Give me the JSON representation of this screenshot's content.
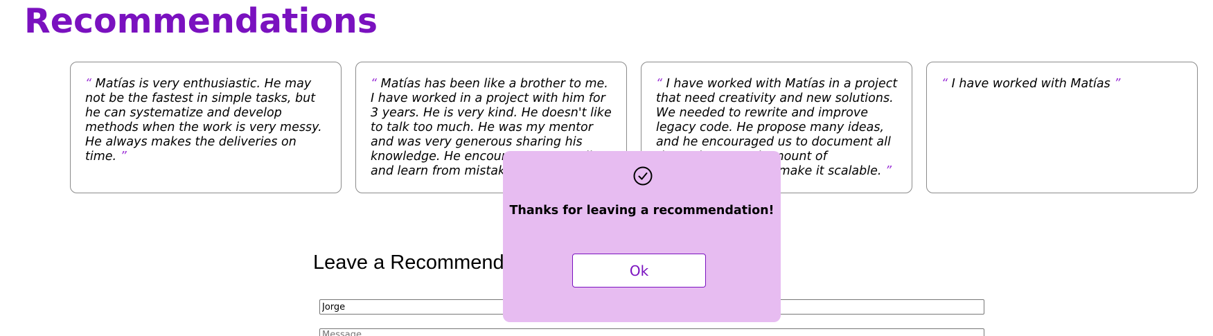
{
  "page": {
    "title": "Recommendations"
  },
  "recommendations": [
    {
      "open_quote": "“",
      "text": "Matías is very enthusiastic. He may not be the fastest in simple tasks, but he can systematize and develop methods when the work is very messy. He always makes the deliveries on time.",
      "close_quote": "”"
    },
    {
      "open_quote": "“",
      "text": "Matías has been like a brother to me. I have worked in a project with him for 3 years. He is very kind. He doesn't like to talk too much. He was my mentor and was very generous sharing his knowledge. He encourages us to talk and learn from mistakes.",
      "close_quote": "”"
    },
    {
      "open_quote": "“",
      "text": "I have worked with Matías in a project that need creativity and new solutions. We needed to rewrite and improve legacy code. He propose many ideas, and he encouraged us to document all the tasks, a good amount of documentation and make it scalable.",
      "close_quote": "”"
    },
    {
      "open_quote": "“",
      "text": "I have worked with Matías",
      "close_quote": "”"
    }
  ],
  "form": {
    "heading": "Leave a Recommendation",
    "name_value": "Jorge",
    "message_placeholder": "Message"
  },
  "modal": {
    "icon": "check-circle-icon",
    "message": "Thanks for leaving a recommendation!",
    "ok_label": "Ok"
  },
  "colors": {
    "accent": "#7a11bf",
    "modal_background": "#e7bcf1",
    "quote_mark": "#9b2fd6"
  }
}
